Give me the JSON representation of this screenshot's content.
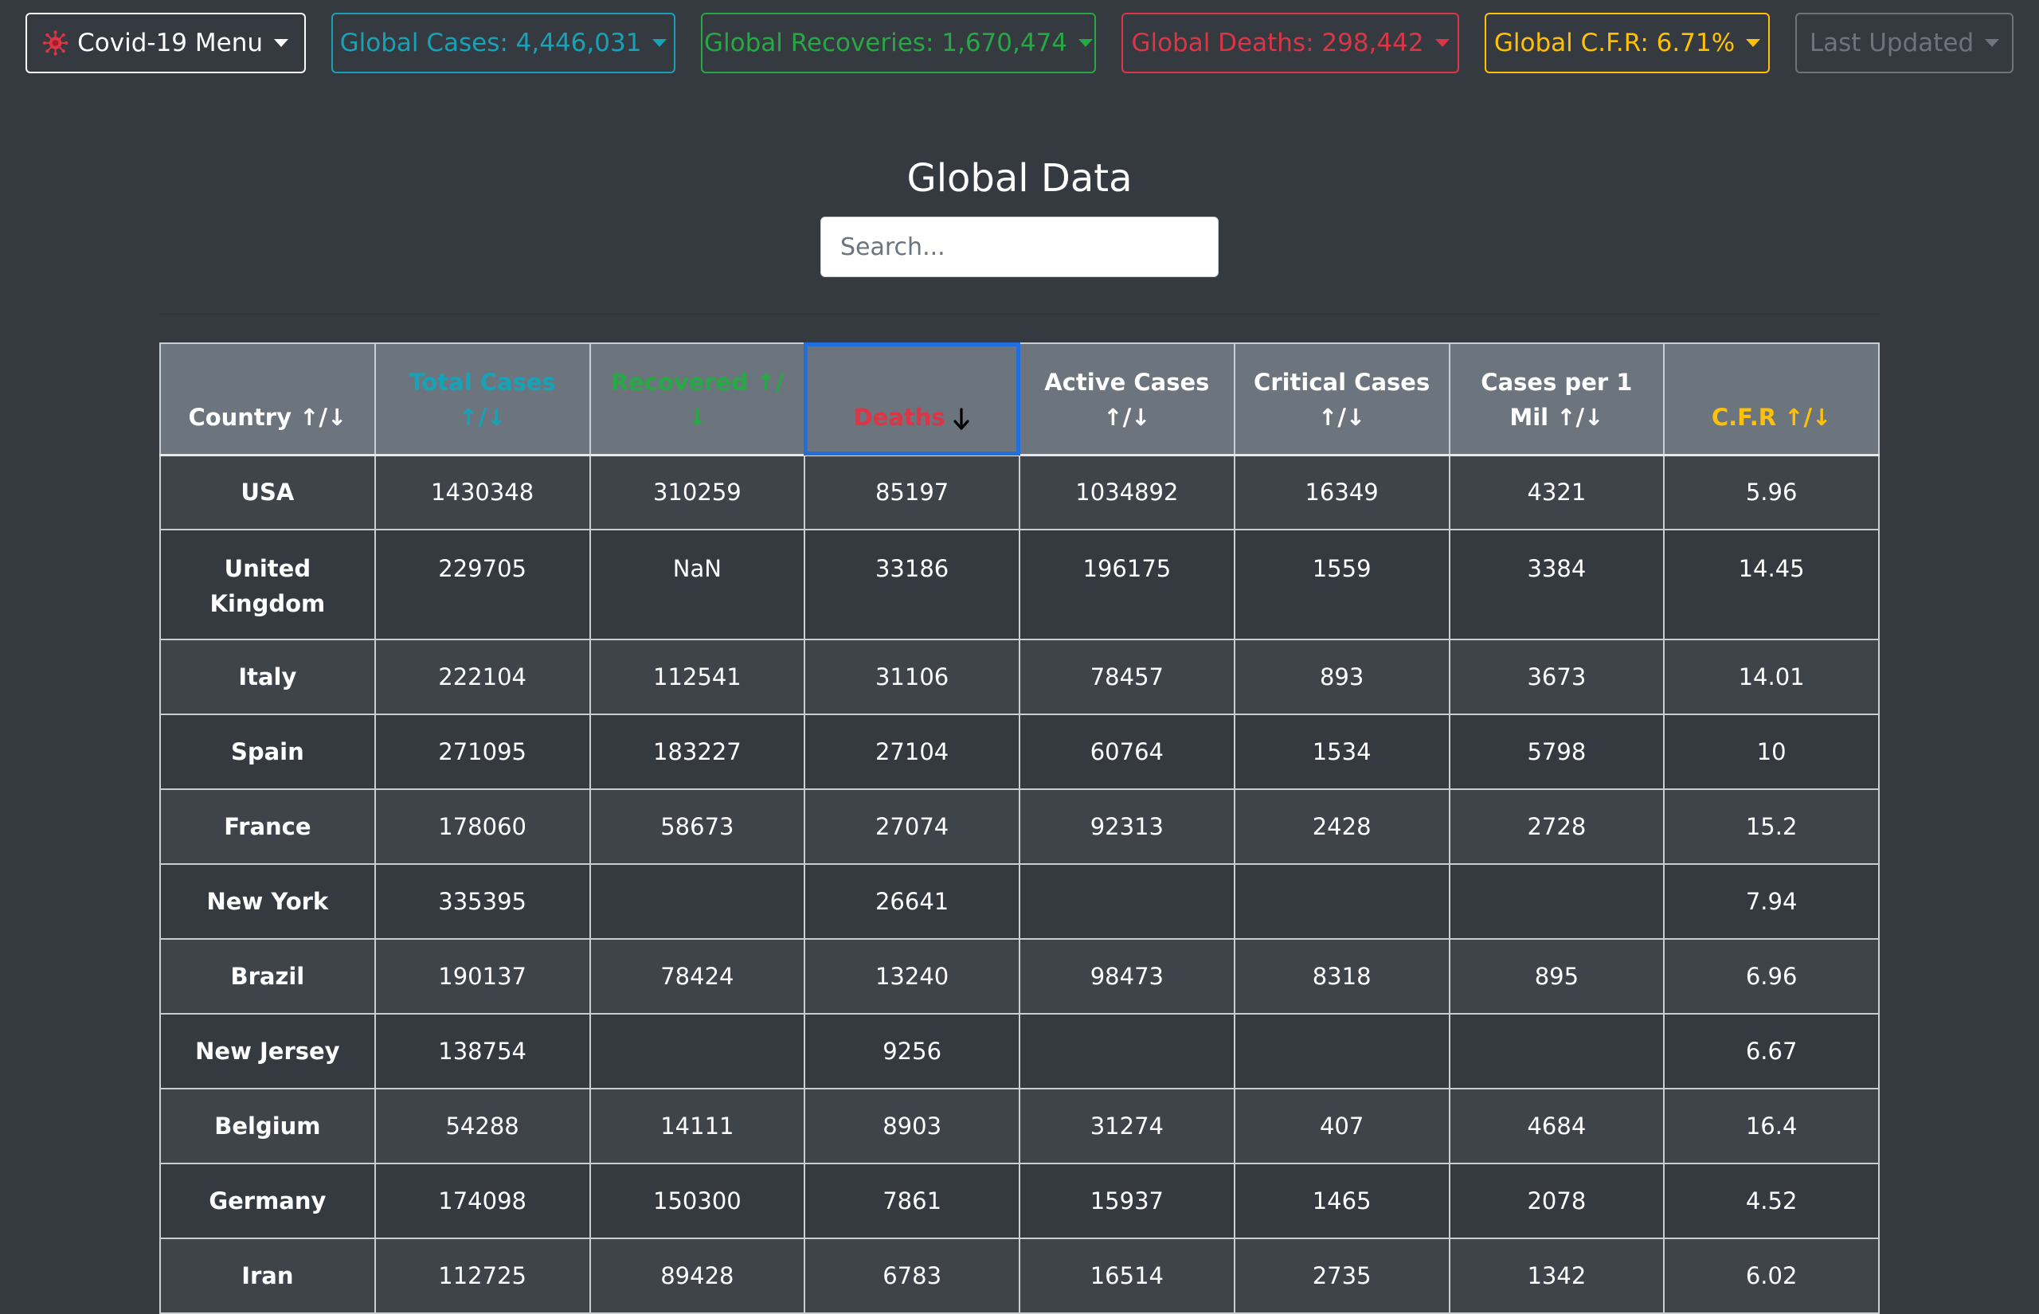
{
  "nav": {
    "menu_label": "Covid-19 Menu",
    "cases_label": "Global Cases: 4,446,031",
    "recoveries_label": "Global Recoveries: 1,670,474",
    "deaths_label": "Global Deaths: 298,442",
    "cfr_label": "Global C.F.R: 6.71%",
    "updated_label": "Last Updated"
  },
  "colors": {
    "background": "#343a40",
    "cases": "#17a2b8",
    "recoveries": "#28a745",
    "deaths": "#dc3545",
    "cfr": "#ffc107",
    "updated": "#6c757d",
    "menu": "#ffffff"
  },
  "page": {
    "title": "Global Data",
    "search_placeholder": "Search..."
  },
  "table": {
    "headers": {
      "country": "Country ↑/↓",
      "total_cases": "Total Cases ↑/↓",
      "recovered": "Recovered ↑/↓",
      "deaths": "Deaths",
      "active_cases": "Active Cases ↑/↓",
      "critical_cases": "Critical Cases ↑/↓",
      "cases_per_mil": "Cases per 1 Mil ↑/↓",
      "cfr": "C.F.R ↑/↓"
    },
    "sorted_by": "deaths",
    "sort_direction_icon": "arrow-down-icon",
    "rows": [
      {
        "country": "USA",
        "total_cases": "1430348",
        "recovered": "310259",
        "deaths": "85197",
        "active": "1034892",
        "critical": "16349",
        "per_mil": "4321",
        "cfr": "5.96"
      },
      {
        "country": "United Kingdom",
        "total_cases": "229705",
        "recovered": "NaN",
        "deaths": "33186",
        "active": "196175",
        "critical": "1559",
        "per_mil": "3384",
        "cfr": "14.45"
      },
      {
        "country": "Italy",
        "total_cases": "222104",
        "recovered": "112541",
        "deaths": "31106",
        "active": "78457",
        "critical": "893",
        "per_mil": "3673",
        "cfr": "14.01"
      },
      {
        "country": "Spain",
        "total_cases": "271095",
        "recovered": "183227",
        "deaths": "27104",
        "active": "60764",
        "critical": "1534",
        "per_mil": "5798",
        "cfr": "10"
      },
      {
        "country": "France",
        "total_cases": "178060",
        "recovered": "58673",
        "deaths": "27074",
        "active": "92313",
        "critical": "2428",
        "per_mil": "2728",
        "cfr": "15.2"
      },
      {
        "country": "New York",
        "total_cases": "335395",
        "recovered": "",
        "deaths": "26641",
        "active": "",
        "critical": "",
        "per_mil": "",
        "cfr": "7.94"
      },
      {
        "country": "Brazil",
        "total_cases": "190137",
        "recovered": "78424",
        "deaths": "13240",
        "active": "98473",
        "critical": "8318",
        "per_mil": "895",
        "cfr": "6.96"
      },
      {
        "country": "New Jersey",
        "total_cases": "138754",
        "recovered": "",
        "deaths": "9256",
        "active": "",
        "critical": "",
        "per_mil": "",
        "cfr": "6.67"
      },
      {
        "country": "Belgium",
        "total_cases": "54288",
        "recovered": "14111",
        "deaths": "8903",
        "active": "31274",
        "critical": "407",
        "per_mil": "4684",
        "cfr": "16.4"
      },
      {
        "country": "Germany",
        "total_cases": "174098",
        "recovered": "150300",
        "deaths": "7861",
        "active": "15937",
        "critical": "1465",
        "per_mil": "2078",
        "cfr": "4.52"
      },
      {
        "country": "Iran",
        "total_cases": "112725",
        "recovered": "89428",
        "deaths": "6783",
        "active": "16514",
        "critical": "2735",
        "per_mil": "1342",
        "cfr": "6.02"
      }
    ]
  }
}
